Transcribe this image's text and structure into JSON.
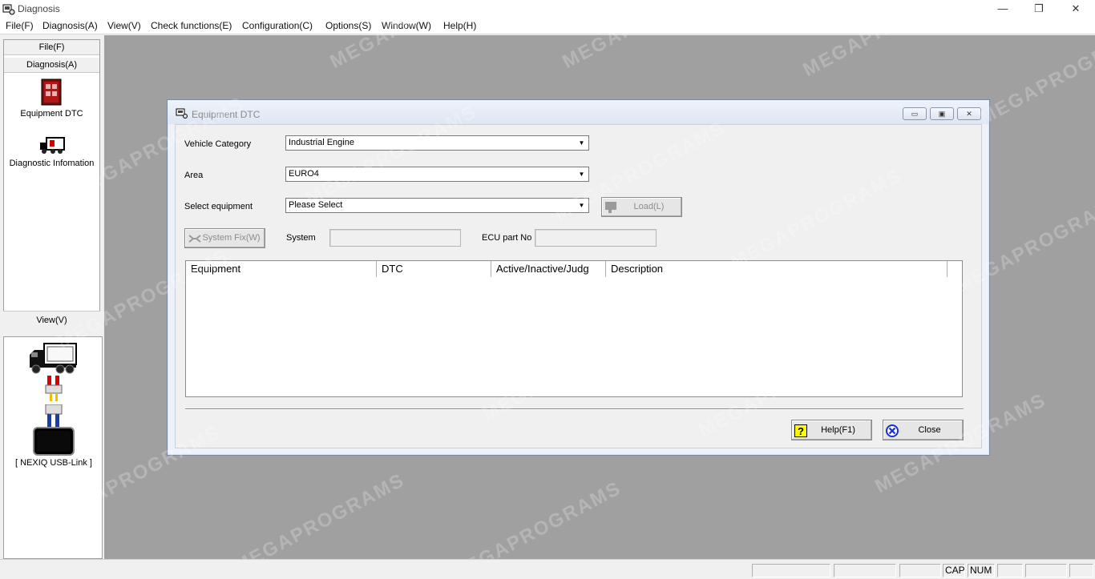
{
  "window": {
    "title": "Diagnosis",
    "controls": {
      "minimize": "—",
      "restore": "❐",
      "close": "✕"
    }
  },
  "menu": [
    "File(F)",
    "Diagnosis(A)",
    "View(V)",
    "Check functions(E)",
    "Configuration(C)",
    "Options(S)",
    "Window(W)",
    "Help(H)"
  ],
  "left_panel": {
    "file_button": "File(F)",
    "diagnosis_button": "Diagnosis(A)",
    "tools": [
      {
        "label": "Equipment DTC",
        "icon": "equipment-dtc-icon"
      },
      {
        "label": "Diagnostic Infomation",
        "icon": "diagnostic-info-icon"
      }
    ],
    "view_button": "View(V)",
    "device_label": "[ NEXIQ USB-Link ]"
  },
  "dialog": {
    "title": "Equipment DTC",
    "controls": {
      "minimize": "▭",
      "maximize": "▣",
      "close": "✕"
    },
    "vehicle_category": {
      "label": "Vehicle Category",
      "value": "Industrial Engine"
    },
    "area": {
      "label": "Area",
      "value": "EURO4"
    },
    "select_equipment": {
      "label": "Select equipment",
      "value": "Please Select"
    },
    "load_button": "Load(L)",
    "system_fix_button": "System Fix(W)",
    "system": {
      "label": "System",
      "value": ""
    },
    "ecu_part_no": {
      "label": "ECU part No",
      "value": ""
    },
    "table": {
      "columns": [
        "Equipment",
        "DTC",
        "Active/Inactive/Judg",
        "Description"
      ],
      "rows": []
    },
    "help_button": "Help(F1)",
    "close_button": "Close"
  },
  "status_bar": {
    "cap": "CAP",
    "num": "NUM"
  },
  "watermark": "MEGAPROGRAMS",
  "colors": {
    "mdi_background": "#a0a0a0",
    "dialog_title_gradient": "#dde6f2",
    "help_icon_yellow": "#ffff00",
    "close_icon_blue": "#1a2fd0"
  }
}
